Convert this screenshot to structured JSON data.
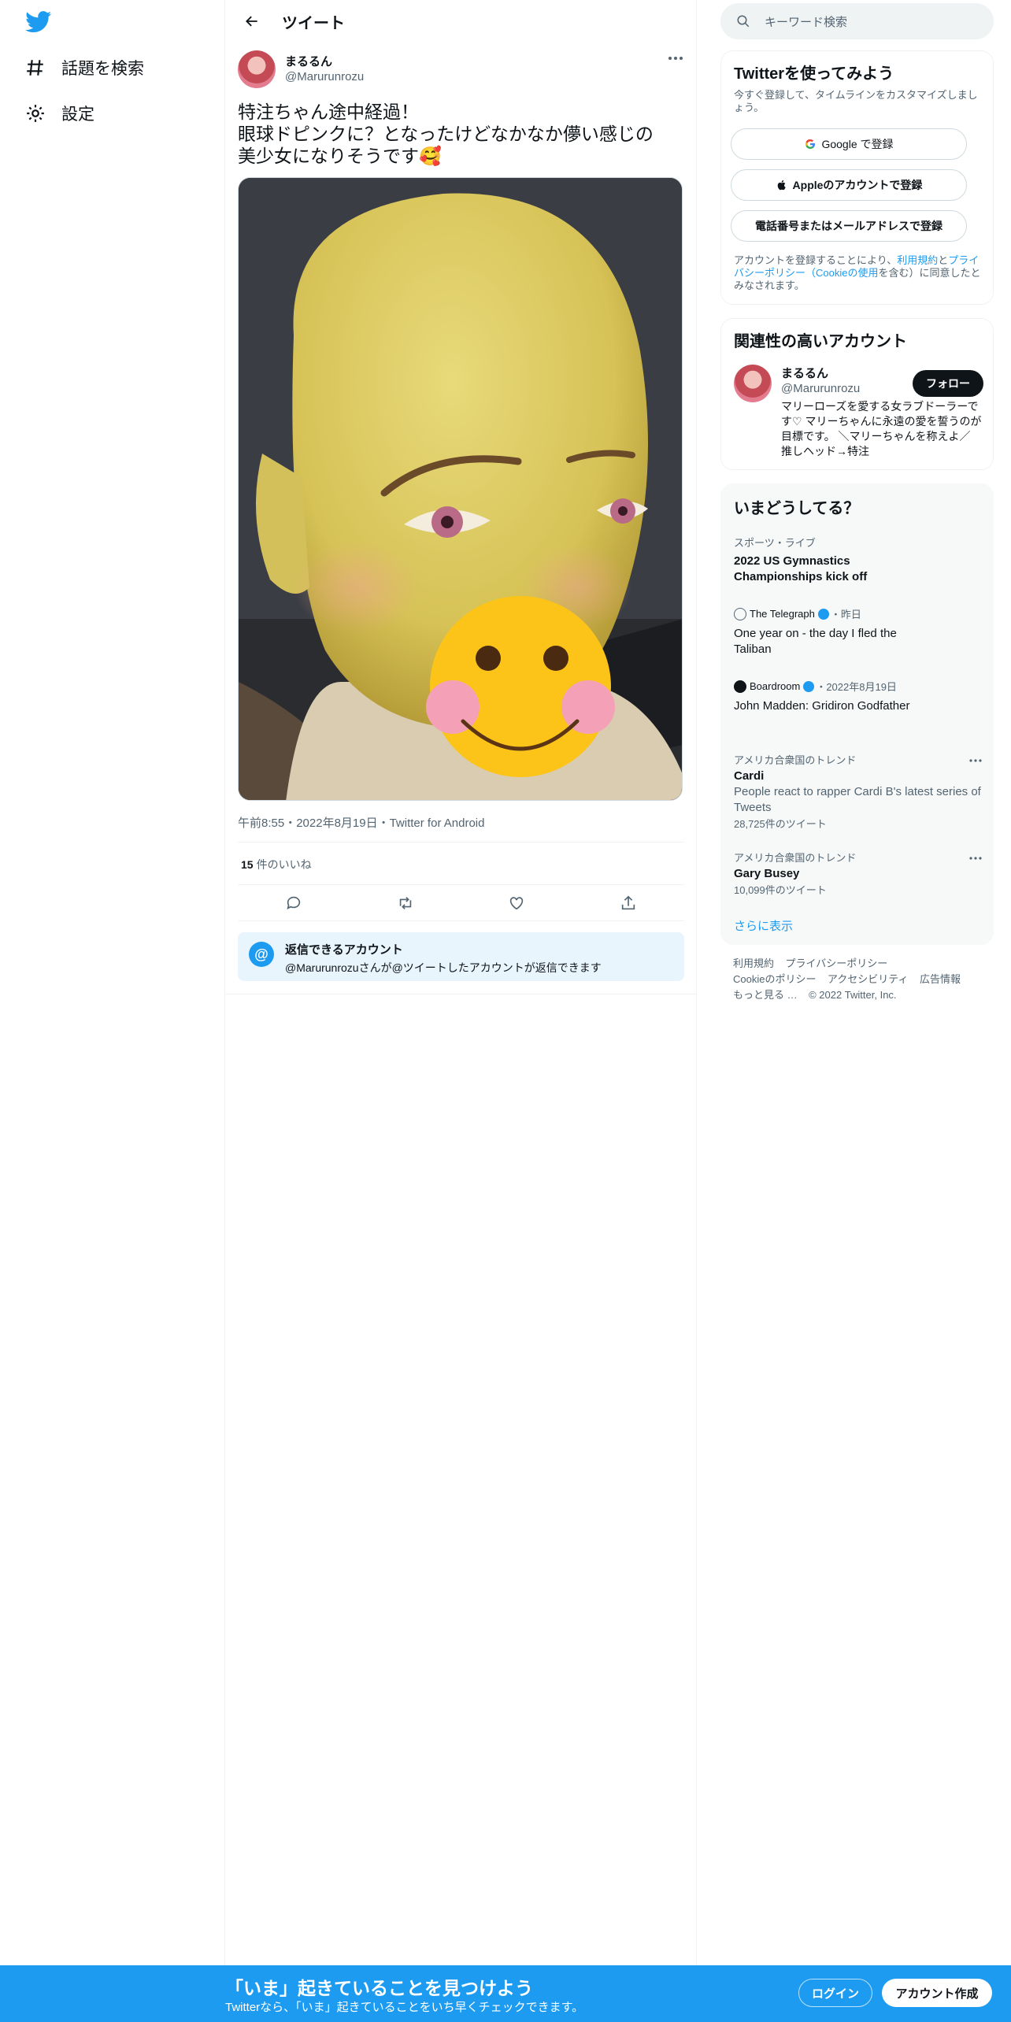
{
  "nav": {
    "explore": "話題を検索",
    "settings": "設定"
  },
  "header": {
    "title": "ツイート"
  },
  "tweet": {
    "name": "まるるん",
    "handle": "@Marurunrozu",
    "line1": "特注ちゃん途中経過！",
    "line2": "眼球ドピンクに？となったけどなかなか儚い感じの",
    "line3": "美少女になりそうです🥰",
    "meta": "午前8:55・2022年8月19日・Twitter for Android",
    "likes_count": "15",
    "likes_label": "件のいいね",
    "reply_title": "返信できるアカウント",
    "reply_sub": "@Marurunrozuさんが@ツイートしたアカウントが返信できます"
  },
  "search": {
    "placeholder": "キーワード検索"
  },
  "signup_card": {
    "title": "Twitterを使ってみよう",
    "sub": "今すぐ登録して、タイムラインをカスタマイズしましょう。",
    "google": "Google で登録",
    "apple": "Appleのアカウントで登録",
    "phone": "電話番号またはメールアドレスで登録",
    "terms_pre": "アカウントを登録することにより、",
    "terms_link1": "利用規約",
    "terms_and": "と",
    "terms_link2": "プライバシーポリシー（Cookieの使用",
    "terms_post": "を含む）に同意したとみなされます。"
  },
  "related": {
    "title": "関連性の高いアカウント",
    "name": "まるるん",
    "handle": "@Marurunrozu",
    "follow": "フォロー",
    "bio": "マリーローズを愛する女ラブドーラーです♡ マリーちゃんに永遠の愛を誓うのが目標です。 ＼マリーちゃんを称えよ／ 推しヘッド→特注"
  },
  "trends": {
    "title": "いまどうしてる？",
    "items": [
      {
        "context": "スポーツ・ライブ",
        "title": "2022 US Gymnastics Championships kick off"
      },
      {
        "source": "The Telegraph",
        "time": "・昨日",
        "title": "One year on - the day I fled the Taliban"
      },
      {
        "source": "Boardroom",
        "time": "・2022年8月19日",
        "title": "John Madden: Gridiron Godfather"
      },
      {
        "context": "アメリカ合衆国のトレンド",
        "title": "Cardi",
        "desc": "People react to rapper Cardi B's latest series of Tweets",
        "count": "28,725件のツイート"
      },
      {
        "context": "アメリカ合衆国のトレンド",
        "title": "Gary Busey",
        "count": "10,099件のツイート"
      }
    ],
    "show_more": "さらに表示"
  },
  "footer": {
    "terms": "利用規約",
    "privacy": "プライバシーポリシー",
    "cookie": "Cookieのポリシー",
    "access": "アクセシビリティ",
    "ads": "広告情報",
    "more": "もっと見る …",
    "copy": "© 2022 Twitter, Inc."
  },
  "banner": {
    "title": "「いま」起きていることを見つけよう",
    "sub": "Twitterなら、「いま」起きていることをいち早くチェックできます。",
    "login": "ログイン",
    "signup": "アカウント作成"
  },
  "colors": {
    "brand": "#1d9bf0",
    "text": "#0f1419",
    "muted": "#536471"
  }
}
